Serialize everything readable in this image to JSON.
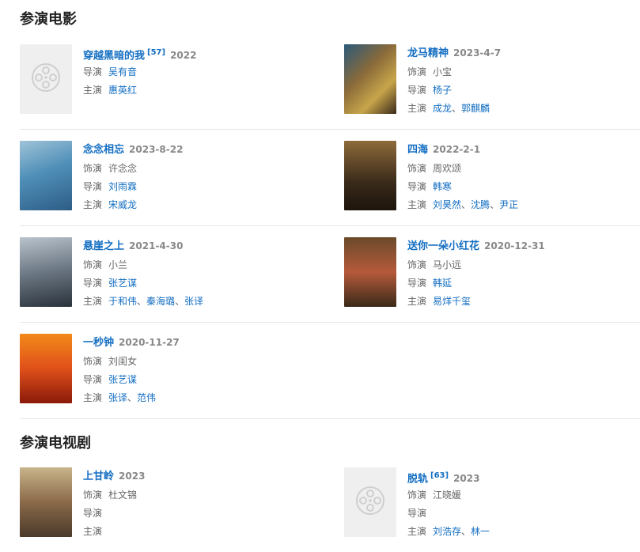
{
  "sections": {
    "movies": {
      "title": "参演电影",
      "items": [
        {
          "title": "穿越黑暗的我",
          "sup": "[57]",
          "date": "2022",
          "role_label": "",
          "role": "",
          "director_label": "导演",
          "director": "吴有音",
          "cast_label": "主演",
          "cast": [
            "惠英红"
          ]
        },
        {
          "title": "龙马精神",
          "date": "2023-4-7",
          "role_label": "饰演",
          "role": "小宝",
          "director_label": "导演",
          "director": "杨子",
          "cast_label": "主演",
          "cast": [
            "成龙",
            "郭麒麟"
          ]
        },
        {
          "title": "念念相忘",
          "date": "2023-8-22",
          "role_label": "饰演",
          "role": "许念念",
          "director_label": "导演",
          "director": "刘雨霖",
          "cast_label": "主演",
          "cast": [
            "宋威龙"
          ]
        },
        {
          "title": "四海",
          "date": "2022-2-1",
          "role_label": "饰演",
          "role": "周欢颂",
          "director_label": "导演",
          "director": "韩寒",
          "cast_label": "主演",
          "cast": [
            "刘昊然",
            "沈腾",
            "尹正"
          ]
        },
        {
          "title": "悬崖之上",
          "date": "2021-4-30",
          "role_label": "饰演",
          "role": "小兰",
          "director_label": "导演",
          "director": "张艺谋",
          "cast_label": "主演",
          "cast": [
            "于和伟",
            "秦海璐",
            "张译"
          ]
        },
        {
          "title": "送你一朵小红花",
          "date": "2020-12-31",
          "role_label": "饰演",
          "role": "马小远",
          "director_label": "导演",
          "director": "韩延",
          "cast_label": "主演",
          "cast": [
            "易烊千玺"
          ]
        },
        {
          "title": "一秒钟",
          "date": "2020-11-27",
          "role_label": "饰演",
          "role": "刘闺女",
          "director_label": "导演",
          "director": "张艺谋",
          "cast_label": "主演",
          "cast": [
            "张译",
            "范伟"
          ]
        }
      ]
    },
    "tv": {
      "title": "参演电视剧",
      "items": [
        {
          "title": "上甘岭",
          "date": "2023",
          "role_label": "饰演",
          "role": "杜文锦",
          "director_label": "导演",
          "director": "",
          "cast_label": "主演",
          "cast": []
        },
        {
          "title": "脱轨",
          "sup": "[63]",
          "date": "2023",
          "role_label": "饰演",
          "role": "江晓媛",
          "director_label": "导演",
          "director": "",
          "cast_label": "主演",
          "cast": [
            "刘浩存",
            "林一"
          ]
        }
      ]
    }
  },
  "cast_separator": "、",
  "icons": {
    "placeholder": "film-reel-icon"
  },
  "colors": {
    "link": "#136ec2",
    "divider": "#e6e6e6",
    "placeholder_bg": "#efefef"
  }
}
